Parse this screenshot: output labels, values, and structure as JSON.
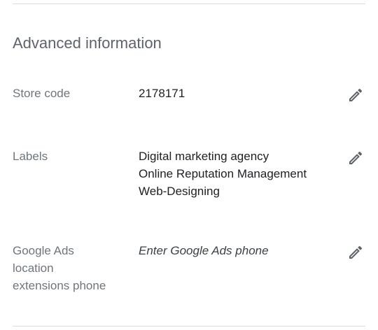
{
  "section": {
    "title": "Advanced information"
  },
  "rows": [
    {
      "label": "Store code",
      "values": [
        "2178171"
      ],
      "edit_icon": "pencil-icon"
    },
    {
      "label": "Labels",
      "values": [
        "Digital marketing agency",
        "Online Reputation Management",
        "Web-Designing"
      ],
      "edit_icon": "pencil-icon"
    },
    {
      "label_lines": [
        "Google Ads",
        "location",
        "extensions phone"
      ],
      "placeholder": "Enter Google Ads phone",
      "edit_icon": "pencil-icon"
    }
  ],
  "colors": {
    "label": "#70757a",
    "value": "#202124",
    "title": "#5f6368",
    "divider": "#dadce0",
    "icon": "#5f6368"
  }
}
